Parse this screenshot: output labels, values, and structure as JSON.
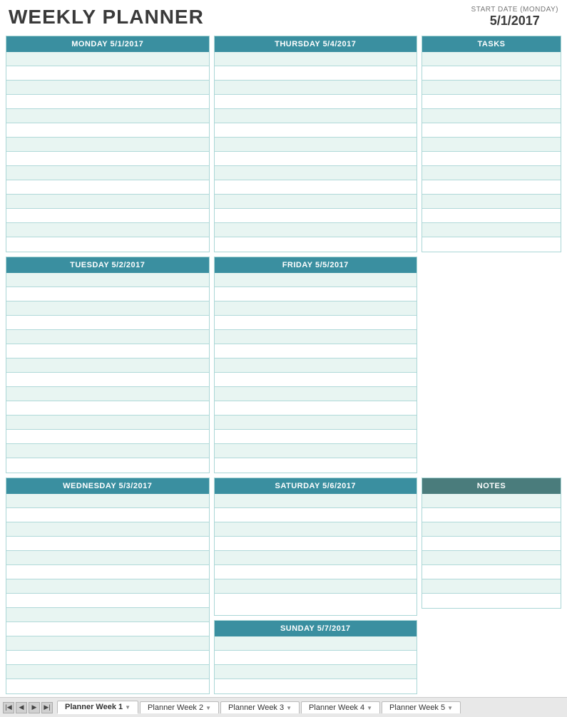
{
  "header": {
    "title": "WEEKLY PLANNER",
    "start_date_label": "START DATE (MONDAY)",
    "start_date_value": "5/1/2017"
  },
  "days": {
    "monday": {
      "label": "MONDAY 5/1/2017",
      "rows": 14
    },
    "tuesday": {
      "label": "TUESDAY 5/2/2017",
      "rows": 14
    },
    "wednesday": {
      "label": "WEDNESDAY 5/3/2017",
      "rows": 14
    },
    "thursday": {
      "label": "THURSDAY 5/4/2017",
      "rows": 14
    },
    "friday": {
      "label": "FRIDAY 5/5/2017",
      "rows": 14
    },
    "saturday": {
      "label": "SATURDAY 5/6/2017",
      "rows": 8
    },
    "sunday": {
      "label": "SUNDAY 5/7/2017",
      "rows": 4
    }
  },
  "tasks": {
    "label": "TASKS",
    "rows": 14
  },
  "notes": {
    "label": "NOTES",
    "rows": 8
  },
  "tabs": [
    {
      "label": "Planner Week 1",
      "active": true
    },
    {
      "label": "Planner Week 2",
      "active": false
    },
    {
      "label": "Planner Week 3",
      "active": false
    },
    {
      "label": "Planner Week 4",
      "active": false
    },
    {
      "label": "Planner Week 5",
      "active": false
    }
  ]
}
